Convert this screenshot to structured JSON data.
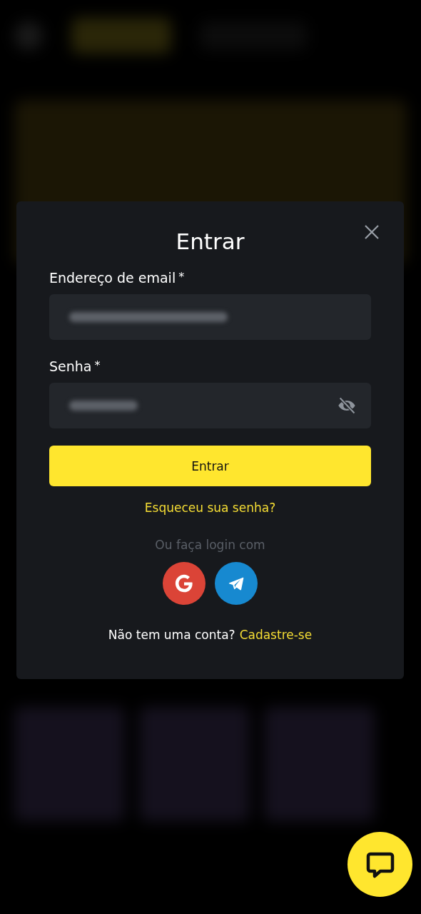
{
  "dialog": {
    "title": "Entrar",
    "fields": [
      {
        "kind": "email",
        "label": "Endereço de email",
        "required_mark": "*"
      },
      {
        "kind": "password",
        "label": "Senha",
        "required_mark": "*"
      }
    ],
    "submit_button": "Entrar",
    "forgot_link": "Esqueceu sua senha?",
    "social_caption": "Ou faça login com",
    "social_buttons": [
      {
        "kind": "google"
      },
      {
        "kind": "telegram"
      }
    ],
    "signup_prompt": "Não tem uma conta?",
    "signup_link": "Cadastre-se"
  }
}
